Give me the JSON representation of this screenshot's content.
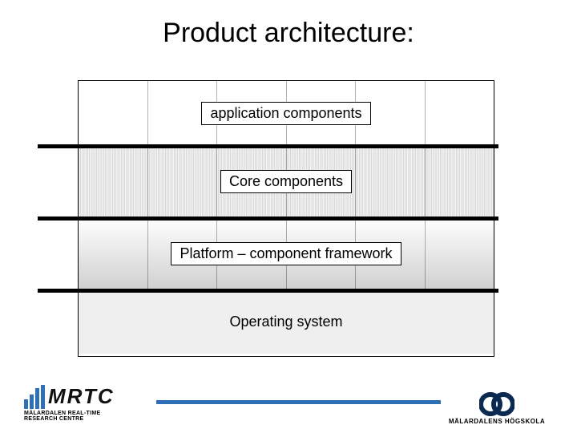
{
  "title": "Product architecture:",
  "layers": {
    "application": "application components",
    "core": "Core components",
    "platform": "Platform – component framework",
    "os": "Operating system"
  },
  "footer": {
    "mrtc": {
      "acronym": "MRTC",
      "full": "MÄLARDALEN REAL-TIME\nRESEARCH CENTRE"
    },
    "school": "MÄLARDALENS HÖGSKOLA"
  }
}
